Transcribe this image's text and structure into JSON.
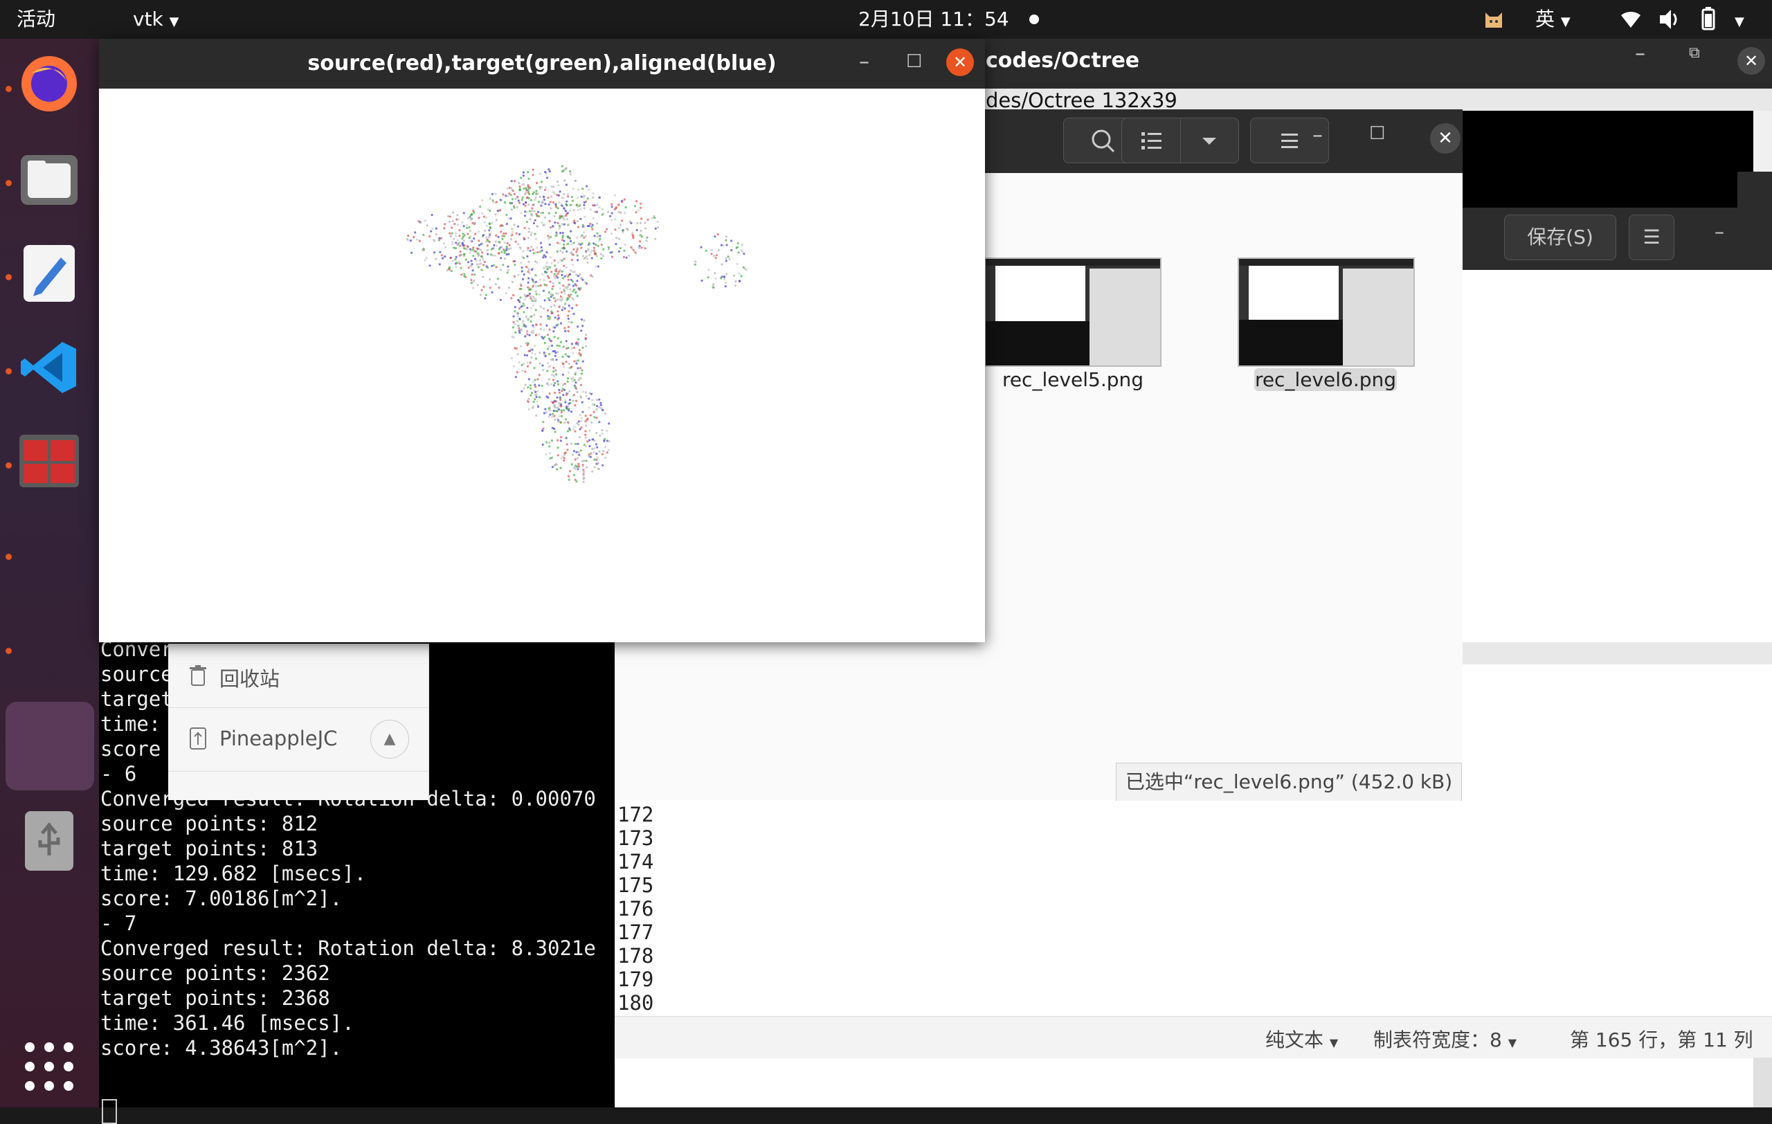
{
  "topbar": {
    "activities": "活动",
    "app_menu": "vtk",
    "clock": "2月10日 11：54",
    "input_method": "英"
  },
  "terminal_bg": {
    "title_partial": "codes/Octree",
    "subtitle_partial": "des/Octree 132x39"
  },
  "terminal": {
    "lines": [
      "Conver",
      "source",
      "target",
      "time:",
      "score",
      "- 6",
      "Converged result: Rotation delta: 0.00070",
      "source points: 812",
      "target points: 813",
      "time: 129.682 [msecs].",
      "score: 7.00186[m^2].",
      "- 7",
      "Converged result: Rotation delta: 8.3021e",
      "source points: 2362",
      "target points: 2368",
      "time: 361.46 [msecs].",
      "score: 4.38643[m^2]."
    ]
  },
  "gedit": {
    "line_numbers": [
      "172",
      "173",
      "174",
      "175",
      "176",
      "177",
      "178",
      "179",
      "180"
    ],
    "save_label": "保存(S)",
    "status_lang": "纯文本",
    "status_tab": "制表符宽度：8",
    "status_pos": "第 165 行，第 11 列"
  },
  "files": {
    "sidebar": [
      {
        "label": "回收站",
        "icon": "trash-icon"
      },
      {
        "label": "PineappleJC",
        "icon": "usb-drive-icon"
      }
    ],
    "items": [
      {
        "name": "rec_level5.png",
        "selected": false
      },
      {
        "name": "rec_level6.png",
        "selected": true
      }
    ],
    "status": "已选中“rec_level6.png” (452.0 kB)"
  },
  "vtk_window": {
    "title": "source(red),target(green),aligned(blue)"
  },
  "colors": {
    "accent": "#e95420",
    "point_red": "#e05050",
    "point_green": "#40b040",
    "point_blue": "#4040d0"
  }
}
